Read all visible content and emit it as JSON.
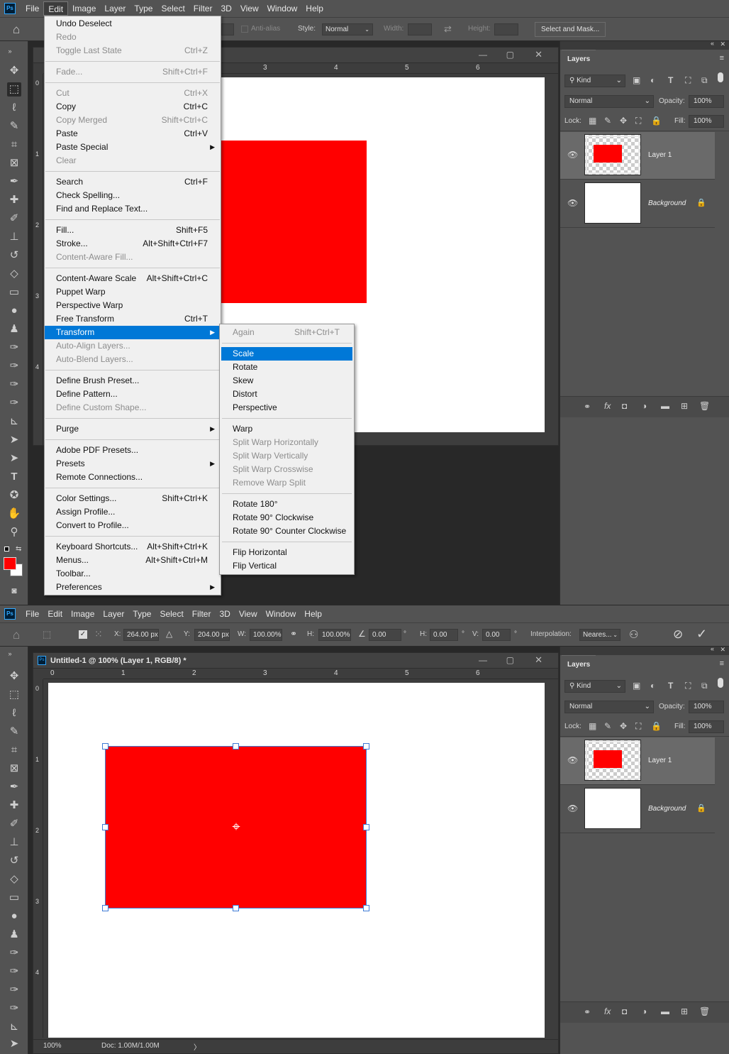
{
  "menubar": {
    "ps": "Ps",
    "items": [
      "File",
      "Edit",
      "Image",
      "Layer",
      "Type",
      "Select",
      "Filter",
      "3D",
      "View",
      "Window",
      "Help"
    ]
  },
  "options_top": {
    "anti_alias": "Anti-alias",
    "style_label": "Style:",
    "style_value": "Normal",
    "width_label": "Width:",
    "height_label": "Height:",
    "select_mask": "Select and Mask..."
  },
  "options_bottom": {
    "x_label": "X:",
    "x_value": "264.00 px",
    "y_label": "Y:",
    "y_value": "204.00 px",
    "w_label": "W:",
    "w_value": "100.00%",
    "h_label": "H:",
    "h_value": "100.00%",
    "angle_value": "0.00",
    "deg": "°",
    "hskew_label": "H:",
    "hskew_value": "0.00",
    "vskew_label": "V:",
    "vskew_value": "0.00",
    "interp_label": "Interpolation:",
    "interp_value": "Neares..."
  },
  "doc": {
    "title": "Untitled-1 @ 100% (Layer 1, RGB/8) *",
    "zoom": "100%",
    "doc_size": "Doc: 1.00M/1.00M",
    "ruler_top": [
      "0",
      "1",
      "2",
      "3",
      "4",
      "5",
      "6"
    ],
    "ruler_left": [
      "0",
      "1",
      "2",
      "3",
      "4"
    ]
  },
  "layers": {
    "tab": "Layers",
    "kind": "Kind",
    "blend": "Normal",
    "opacity_label": "Opacity:",
    "opacity": "100%",
    "lock_label": "Lock:",
    "fill_label": "Fill:",
    "fill": "100%",
    "items": [
      {
        "name": "Layer 1"
      },
      {
        "name": "Background"
      }
    ]
  },
  "edit_menu": [
    {
      "label": "Undo Deselect",
      "sc": "",
      "dis": false
    },
    {
      "label": "Redo",
      "sc": "",
      "dis": true
    },
    {
      "label": "Toggle Last State",
      "sc": "Ctrl+Z",
      "dis": true
    },
    {
      "sep": true
    },
    {
      "label": "Fade...",
      "sc": "Shift+Ctrl+F",
      "dis": true
    },
    {
      "sep": true
    },
    {
      "label": "Cut",
      "sc": "Ctrl+X",
      "dis": true
    },
    {
      "label": "Copy",
      "sc": "Ctrl+C",
      "dis": false
    },
    {
      "label": "Copy Merged",
      "sc": "Shift+Ctrl+C",
      "dis": true
    },
    {
      "label": "Paste",
      "sc": "Ctrl+V",
      "dis": false
    },
    {
      "label": "Paste Special",
      "sc": "",
      "dis": false,
      "sub": true
    },
    {
      "label": "Clear",
      "sc": "",
      "dis": true
    },
    {
      "sep": true
    },
    {
      "label": "Search",
      "sc": "Ctrl+F",
      "dis": false
    },
    {
      "label": "Check Spelling...",
      "sc": "",
      "dis": false
    },
    {
      "label": "Find and Replace Text...",
      "sc": "",
      "dis": false
    },
    {
      "sep": true
    },
    {
      "label": "Fill...",
      "sc": "Shift+F5",
      "dis": false
    },
    {
      "label": "Stroke...",
      "sc": "Alt+Shift+Ctrl+F7",
      "dis": false
    },
    {
      "label": "Content-Aware Fill...",
      "sc": "",
      "dis": true
    },
    {
      "sep": true
    },
    {
      "label": "Content-Aware Scale",
      "sc": "Alt+Shift+Ctrl+C",
      "dis": false
    },
    {
      "label": "Puppet Warp",
      "sc": "",
      "dis": false
    },
    {
      "label": "Perspective Warp",
      "sc": "",
      "dis": false
    },
    {
      "label": "Free Transform",
      "sc": "Ctrl+T",
      "dis": false
    },
    {
      "label": "Transform",
      "sc": "",
      "dis": false,
      "sub": true,
      "hl": true
    },
    {
      "label": "Auto-Align Layers...",
      "sc": "",
      "dis": true
    },
    {
      "label": "Auto-Blend Layers...",
      "sc": "",
      "dis": true
    },
    {
      "sep": true
    },
    {
      "label": "Define Brush Preset...",
      "sc": "",
      "dis": false
    },
    {
      "label": "Define Pattern...",
      "sc": "",
      "dis": false
    },
    {
      "label": "Define Custom Shape...",
      "sc": "",
      "dis": true
    },
    {
      "sep": true
    },
    {
      "label": "Purge",
      "sc": "",
      "dis": false,
      "sub": true
    },
    {
      "sep": true
    },
    {
      "label": "Adobe PDF Presets...",
      "sc": "",
      "dis": false
    },
    {
      "label": "Presets",
      "sc": "",
      "dis": false,
      "sub": true
    },
    {
      "label": "Remote Connections...",
      "sc": "",
      "dis": false
    },
    {
      "sep": true
    },
    {
      "label": "Color Settings...",
      "sc": "Shift+Ctrl+K",
      "dis": false
    },
    {
      "label": "Assign Profile...",
      "sc": "",
      "dis": false
    },
    {
      "label": "Convert to Profile...",
      "sc": "",
      "dis": false
    },
    {
      "sep": true
    },
    {
      "label": "Keyboard Shortcuts...",
      "sc": "Alt+Shift+Ctrl+K",
      "dis": false
    },
    {
      "label": "Menus...",
      "sc": "Alt+Shift+Ctrl+M",
      "dis": false
    },
    {
      "label": "Toolbar...",
      "sc": "",
      "dis": false
    },
    {
      "label": "Preferences",
      "sc": "",
      "dis": false,
      "sub": true
    }
  ],
  "transform_menu": [
    {
      "label": "Again",
      "sc": "Shift+Ctrl+T",
      "dis": true
    },
    {
      "sep": true
    },
    {
      "label": "Scale",
      "sc": "",
      "dis": false,
      "hl": true
    },
    {
      "label": "Rotate",
      "sc": "",
      "dis": false
    },
    {
      "label": "Skew",
      "sc": "",
      "dis": false
    },
    {
      "label": "Distort",
      "sc": "",
      "dis": false
    },
    {
      "label": "Perspective",
      "sc": "",
      "dis": false
    },
    {
      "sep": true
    },
    {
      "label": "Warp",
      "sc": "",
      "dis": false
    },
    {
      "label": "Split Warp Horizontally",
      "sc": "",
      "dis": true
    },
    {
      "label": "Split Warp Vertically",
      "sc": "",
      "dis": true
    },
    {
      "label": "Split Warp Crosswise",
      "sc": "",
      "dis": true
    },
    {
      "label": "Remove Warp Split",
      "sc": "",
      "dis": true
    },
    {
      "sep": true
    },
    {
      "label": "Rotate 180°",
      "sc": "",
      "dis": false
    },
    {
      "label": "Rotate 90° Clockwise",
      "sc": "",
      "dis": false
    },
    {
      "label": "Rotate 90° Counter Clockwise",
      "sc": "",
      "dis": false
    },
    {
      "sep": true
    },
    {
      "label": "Flip Horizontal",
      "sc": "",
      "dis": false
    },
    {
      "label": "Flip Vertical",
      "sc": "",
      "dis": false
    }
  ],
  "colors": {
    "accent": "#0078d7",
    "fg": "#ff0000",
    "bg": "#ffffff"
  }
}
